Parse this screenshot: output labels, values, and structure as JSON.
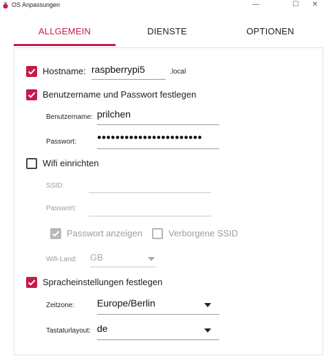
{
  "window": {
    "title": "OS Anpassungen",
    "minimize_glyph": "—",
    "maximize_glyph": "☐",
    "close_glyph": "✕"
  },
  "tabs": [
    {
      "label": "ALLGEMEIN",
      "active": true
    },
    {
      "label": "DIENSTE",
      "active": false
    },
    {
      "label": "OPTIONEN",
      "active": false
    }
  ],
  "general": {
    "hostname": {
      "label": "Hostname:",
      "value": "raspberrypi5",
      "suffix": ".local",
      "checked": true
    },
    "user": {
      "label": "Benutzername und Passwort festlegen",
      "checked": true,
      "username_label": "Benutzername:",
      "username_value": "prilchen",
      "password_label": "Passwort:",
      "password_value": "●●●●●●●●●●●●●●●●●●●●●●●"
    },
    "wifi": {
      "label": "Wifi einrichten",
      "checked": false,
      "ssid_label": "SSID:",
      "password_label": "Passwort:",
      "show_password_label": "Passwort anzeigen",
      "show_password_checked": true,
      "hidden_ssid_label": "Verborgene SSID",
      "hidden_ssid_checked": false,
      "country_label": "Wifi-Land:",
      "country_value": "GB"
    },
    "locale": {
      "label": "Spracheinstellungen festlegen",
      "checked": true,
      "timezone_label": "Zeitzone:",
      "timezone_value": "Europe/Berlin",
      "keyboard_label": "Tastaturlayout:",
      "keyboard_value": "de"
    }
  },
  "colors": {
    "accent": "#c51a4a",
    "disabled": "#9c9c9c"
  },
  "icons": {
    "app": "raspberry-logo-icon",
    "check": "checkmark-icon",
    "dropdown": "dropdown-arrow-icon"
  }
}
